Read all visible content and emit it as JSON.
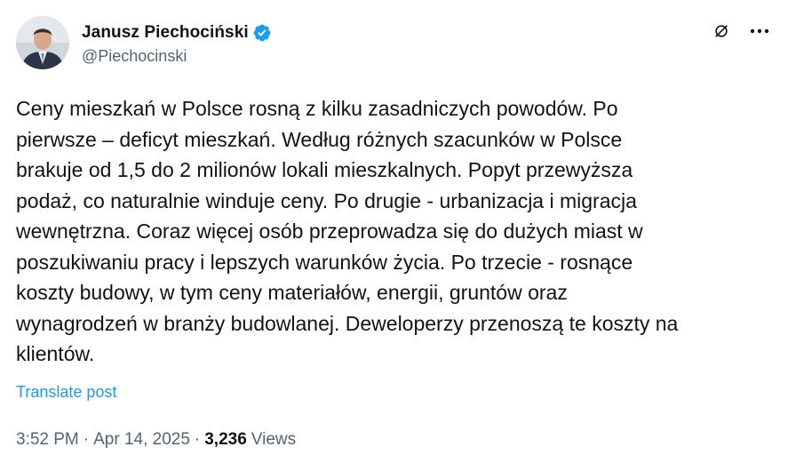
{
  "author": {
    "display_name": "Janusz Piechociński",
    "handle": "@Piechocinski",
    "verified_icon": "verified-badge-icon",
    "avatar_icon": "avatar"
  },
  "actions": {
    "grok_icon": "grok-icon",
    "more_icon": "more-icon",
    "more_label": "•••"
  },
  "post": {
    "text": "Ceny mieszkań w Polsce rosną z kilku zasadniczych powodów. Po\npierwsze – deficyt mieszkań. Według różnych szacunków w Polsce\nbrakuje od 1,5 do 2 milionów lokali mieszkalnych. Popyt przewyższa\npodaż, co naturalnie winduje ceny. Po drugie - urbanizacja i migracja\nwewnętrzna. Coraz więcej osób przeprowadza się do dużych miast w\nposzukiwaniu pracy i lepszych warunków życia. Po trzecie - rosnące\nkoszty budowy, w tym ceny materiałów, energii, gruntów oraz\nwynagrodzeń w branży budowlanej. Deweloperzy przenoszą te koszty na\nklientów.",
    "translate_label": "Translate post"
  },
  "meta": {
    "time": "3:52 PM",
    "separator": "·",
    "date": "Apr 14, 2025",
    "views_count": "3,236",
    "views_label": "Views"
  },
  "colors": {
    "text": "#0f1419",
    "secondary": "#536471",
    "link": "#1d9bf0",
    "verified": "#1d9bf0"
  }
}
